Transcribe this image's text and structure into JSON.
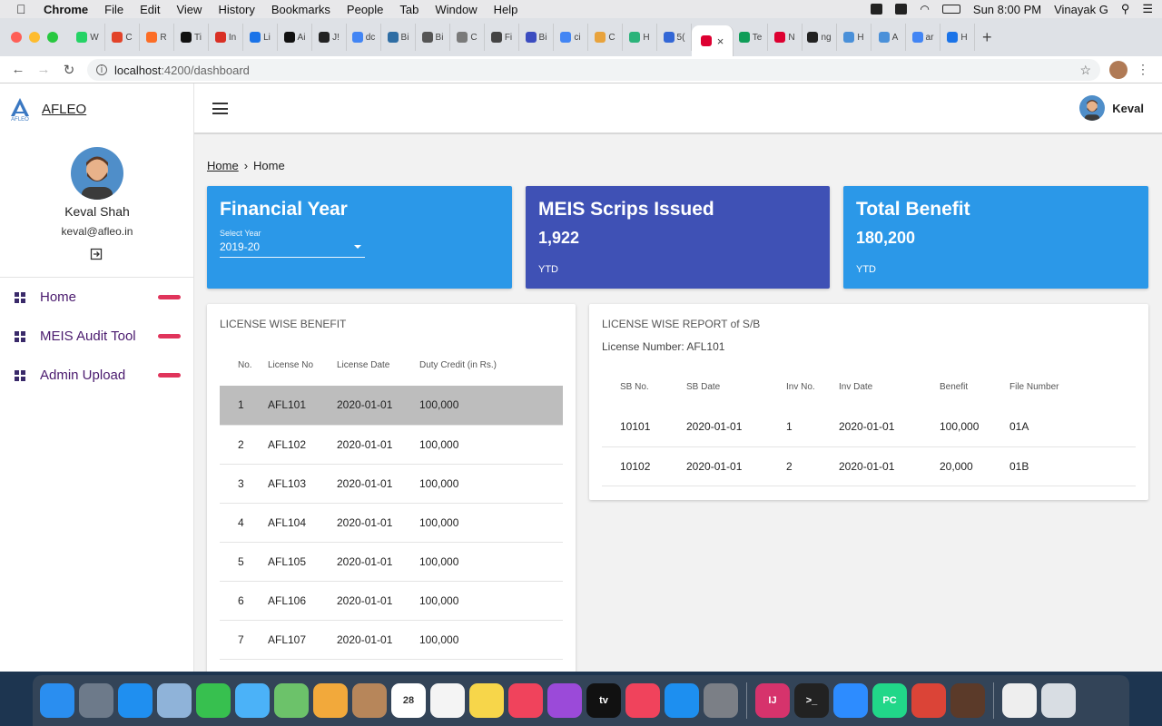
{
  "mac_menu": {
    "app": "Chrome",
    "items": [
      "File",
      "Edit",
      "View",
      "History",
      "Bookmarks",
      "People",
      "Tab",
      "Window",
      "Help"
    ],
    "clock": "Sun 8:00 PM",
    "user": "Vinayak G"
  },
  "browser": {
    "tabs": [
      {
        "letter": "W",
        "color": "#25d366"
      },
      {
        "letter": "C",
        "color": "#e24329"
      },
      {
        "letter": "R",
        "color": "#fc6d26"
      },
      {
        "letter": "Ti",
        "color": "#111111"
      },
      {
        "letter": "In",
        "color": "#d93025"
      },
      {
        "letter": "Li",
        "color": "#1a73e8"
      },
      {
        "letter": "Ai",
        "color": "#111111"
      },
      {
        "letter": "J!",
        "color": "#222222"
      },
      {
        "letter": "dc",
        "color": "#4285f4"
      },
      {
        "letter": "Bi",
        "color": "#2e6da4"
      },
      {
        "letter": "Bi",
        "color": "#555555"
      },
      {
        "letter": "C",
        "color": "#7a7a7a"
      },
      {
        "letter": "Fi",
        "color": "#444444"
      },
      {
        "letter": "Bi",
        "color": "#3b4cc0"
      },
      {
        "letter": "ci",
        "color": "#4285f4"
      },
      {
        "letter": "C",
        "color": "#e8a33d"
      },
      {
        "letter": "H",
        "color": "#2bb37a"
      },
      {
        "letter": "5(",
        "color": "#3367d6"
      },
      {
        "letter": "",
        "color": "#dd0031",
        "active": true
      },
      {
        "letter": "Te",
        "color": "#0f9d58"
      },
      {
        "letter": "N",
        "color": "#dd0031"
      },
      {
        "letter": "ng",
        "color": "#222222"
      },
      {
        "letter": "H",
        "color": "#4a90d9"
      },
      {
        "letter": "A",
        "color": "#4a90d9"
      },
      {
        "letter": "ar",
        "color": "#4285f4"
      },
      {
        "letter": "H",
        "color": "#1a73e8"
      }
    ],
    "url_host": "localhost",
    "url_rest": ":4200/dashboard"
  },
  "app": {
    "brand": "AFLEO",
    "profile": {
      "name": "Keval Shah",
      "email": "keval@afleo.in"
    },
    "nav": [
      {
        "label": "Home"
      },
      {
        "label": "MEIS Audit Tool"
      },
      {
        "label": "Admin Upload"
      }
    ],
    "topbar_user": "Keval",
    "breadcrumb": {
      "root": "Home",
      "current": "Home"
    },
    "cards": {
      "fy": {
        "title": "Financial Year",
        "select_label": "Select Year",
        "select_value": "2019-20",
        "color": "#2b98e8"
      },
      "meis": {
        "title": "MEIS Scrips Issued",
        "value": "1,922",
        "sub": "YTD",
        "color": "#3f51b5"
      },
      "benefit": {
        "title": "Total Benefit",
        "value": "180,200",
        "sub": "YTD",
        "color": "#2b98e8"
      }
    },
    "license_benefit": {
      "title": "LICENSE WISE BENEFIT",
      "headers": [
        "No.",
        "License No",
        "License Date",
        "Duty Credit (in Rs.)"
      ],
      "rows": [
        [
          "1",
          "AFL101",
          "2020-01-01",
          "100,000"
        ],
        [
          "2",
          "AFL102",
          "2020-01-01",
          "100,000"
        ],
        [
          "3",
          "AFL103",
          "2020-01-01",
          "100,000"
        ],
        [
          "4",
          "AFL104",
          "2020-01-01",
          "100,000"
        ],
        [
          "5",
          "AFL105",
          "2020-01-01",
          "100,000"
        ],
        [
          "6",
          "AFL106",
          "2020-01-01",
          "100,000"
        ],
        [
          "7",
          "AFL107",
          "2020-01-01",
          "100,000"
        ]
      ]
    },
    "license_report": {
      "title": "LICENSE WISE REPORT of S/B",
      "license_number": "License Number: AFL101",
      "headers": [
        "SB No.",
        "SB Date",
        "Inv No.",
        "Inv Date",
        "Benefit",
        "File Number"
      ],
      "rows": [
        [
          "10101",
          "2020-01-01",
          "1",
          "2020-01-01",
          "100,000",
          "01A"
        ],
        [
          "10102",
          "2020-01-01",
          "2",
          "2020-01-01",
          "20,000",
          "01B"
        ]
      ]
    }
  },
  "dock": [
    {
      "name": "finder-icon",
      "color": "#2a8ef0",
      "label": ""
    },
    {
      "name": "launchpad-icon",
      "color": "#6d7a8a",
      "label": ""
    },
    {
      "name": "safari-icon",
      "color": "#1f8ff0",
      "label": ""
    },
    {
      "name": "preview-icon",
      "color": "#8fb3d9",
      "label": ""
    },
    {
      "name": "facetime-icon",
      "color": "#37c04f",
      "label": ""
    },
    {
      "name": "messages-icon",
      "color": "#4bb2f8",
      "label": ""
    },
    {
      "name": "maps-icon",
      "color": "#6cc26a",
      "label": ""
    },
    {
      "name": "photos-icon",
      "color": "#f2a93b",
      "label": ""
    },
    {
      "name": "contacts-icon",
      "color": "#b7865a",
      "label": ""
    },
    {
      "name": "calendar-icon",
      "color": "#ffffff",
      "label": "28"
    },
    {
      "name": "reminders-icon",
      "color": "#f4f4f4",
      "label": ""
    },
    {
      "name": "notes-icon",
      "color": "#f7d64a",
      "label": ""
    },
    {
      "name": "music-icon",
      "color": "#f0435c",
      "label": ""
    },
    {
      "name": "podcasts-icon",
      "color": "#9b4ad9",
      "label": ""
    },
    {
      "name": "tv-icon",
      "color": "#111111",
      "label": "tv"
    },
    {
      "name": "news-icon",
      "color": "#f0435c",
      "label": ""
    },
    {
      "name": "app-store-icon",
      "color": "#1d8ff0",
      "label": ""
    },
    {
      "name": "system-preferences-icon",
      "color": "#7b7f86",
      "label": ""
    },
    {
      "name": "intellij-icon",
      "color": "#d6336c",
      "label": "IJ"
    },
    {
      "name": "terminal-icon",
      "color": "#222222",
      "label": ">_"
    },
    {
      "name": "zoom-icon",
      "color": "#2d8cff",
      "label": ""
    },
    {
      "name": "pycharm-icon",
      "color": "#21d789",
      "label": "PC"
    },
    {
      "name": "chrome-icon",
      "color": "#db4437",
      "label": ""
    },
    {
      "name": "app-icon",
      "color": "#5b3a29",
      "label": ""
    },
    {
      "name": "downloads-icon",
      "color": "#eeeeee",
      "label": ""
    },
    {
      "name": "trash-icon",
      "color": "#d8dde3",
      "label": ""
    }
  ]
}
